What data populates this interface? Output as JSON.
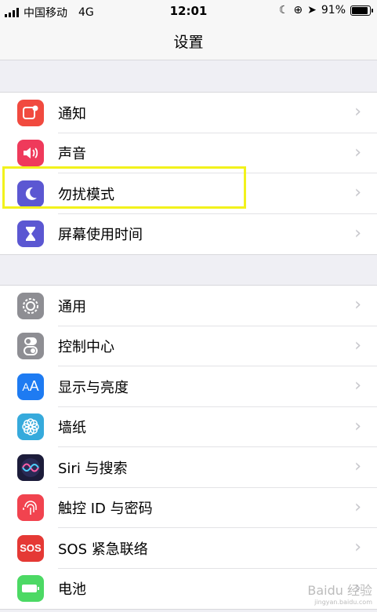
{
  "status_bar": {
    "carrier": "中国移动",
    "network": "4G",
    "time": "12:01",
    "battery": "91%",
    "battery_level": 0.91
  },
  "nav": {
    "title": "设置"
  },
  "group1": [
    {
      "label": "通知",
      "icon": "notification-icon",
      "color": "#f14a3f"
    },
    {
      "label": "声音",
      "icon": "sound-icon",
      "color": "#ef3a5b"
    },
    {
      "label": "勿扰模式",
      "icon": "moon-icon",
      "color": "#5b57d2"
    },
    {
      "label": "屏幕使用时间",
      "icon": "hourglass-icon",
      "color": "#5b57d2"
    }
  ],
  "group2": [
    {
      "label": "通用",
      "icon": "gear-icon",
      "color": "#8e8e93"
    },
    {
      "label": "控制中心",
      "icon": "toggles-icon",
      "color": "#8e8e93"
    },
    {
      "label": "显示与亮度",
      "icon": "text-size-icon",
      "color": "#1e7bf2"
    },
    {
      "label": "墙纸",
      "icon": "flower-icon",
      "color": "#36aadc"
    },
    {
      "label": "Siri 与搜索",
      "icon": "siri-icon",
      "color": "#1c1c3a"
    },
    {
      "label": "触控 ID 与密码",
      "icon": "fingerprint-icon",
      "color": "#f1434f"
    },
    {
      "label": "SOS 紧急联络",
      "icon": "sos-icon",
      "color": "#e53935"
    },
    {
      "label": "电池",
      "icon": "battery-icon",
      "color": "#4cd964"
    }
  ],
  "watermark": {
    "text": "Baidu 经验",
    "sub": "jingyan.baidu.com"
  }
}
